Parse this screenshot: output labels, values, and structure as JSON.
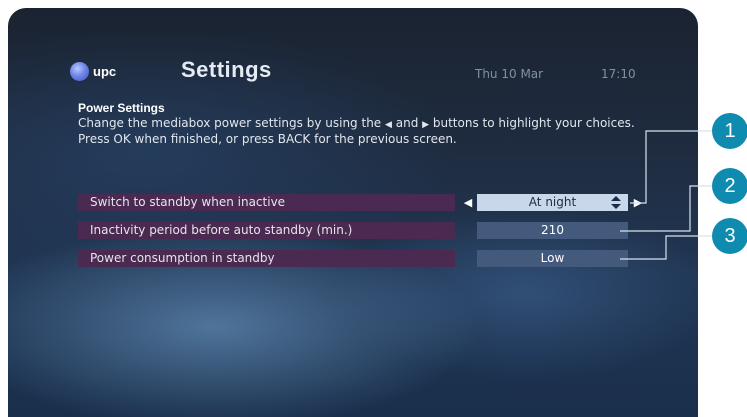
{
  "header": {
    "logo_text": "upc",
    "title": "Settings",
    "date": "Thu 10 Mar",
    "time": "17:10"
  },
  "section": {
    "title": "Power Settings",
    "desc_part1": "Change the mediabox power settings by using the ",
    "desc_and": " and ",
    "desc_part2": " buttons to highlight your choices. Press OK when finished, or press BACK for the previous screen."
  },
  "rows": [
    {
      "label": "Switch to standby when inactive",
      "value": "At night",
      "selected": true
    },
    {
      "label": "Inactivity period before auto standby (min.)",
      "value": "210",
      "selected": false
    },
    {
      "label": "Power consumption in standby",
      "value": "Low",
      "selected": false
    }
  ],
  "callouts": [
    "1",
    "2",
    "3"
  ],
  "colors": {
    "row_label_bg": "#4a2a50",
    "value_bg": "#445a7c",
    "selected_value_bg": "#c8d7ea",
    "callout": "#0f8bb0"
  }
}
